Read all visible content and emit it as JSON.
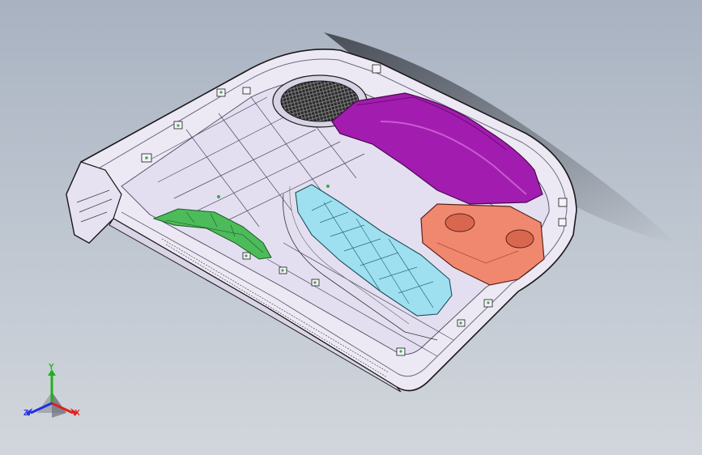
{
  "viewport": {
    "background_top": "#a9b2c1",
    "background_bottom": "#d2d6dc"
  },
  "model": {
    "shell_color": "#ede9f4",
    "edge_color": "#1a1a1a",
    "parts": {
      "duct_color": "#a21caf",
      "block_color": "#f08870",
      "panel_color": "#9fe0f0",
      "pcb_color": "#4cbb5a",
      "fan_grille_icon": "grille-icon"
    }
  },
  "triad": {
    "x_label": "X",
    "y_label": "Y",
    "z_label": "Z",
    "x_color": "#e02020",
    "y_color": "#20b020",
    "z_color": "#2030e0"
  }
}
